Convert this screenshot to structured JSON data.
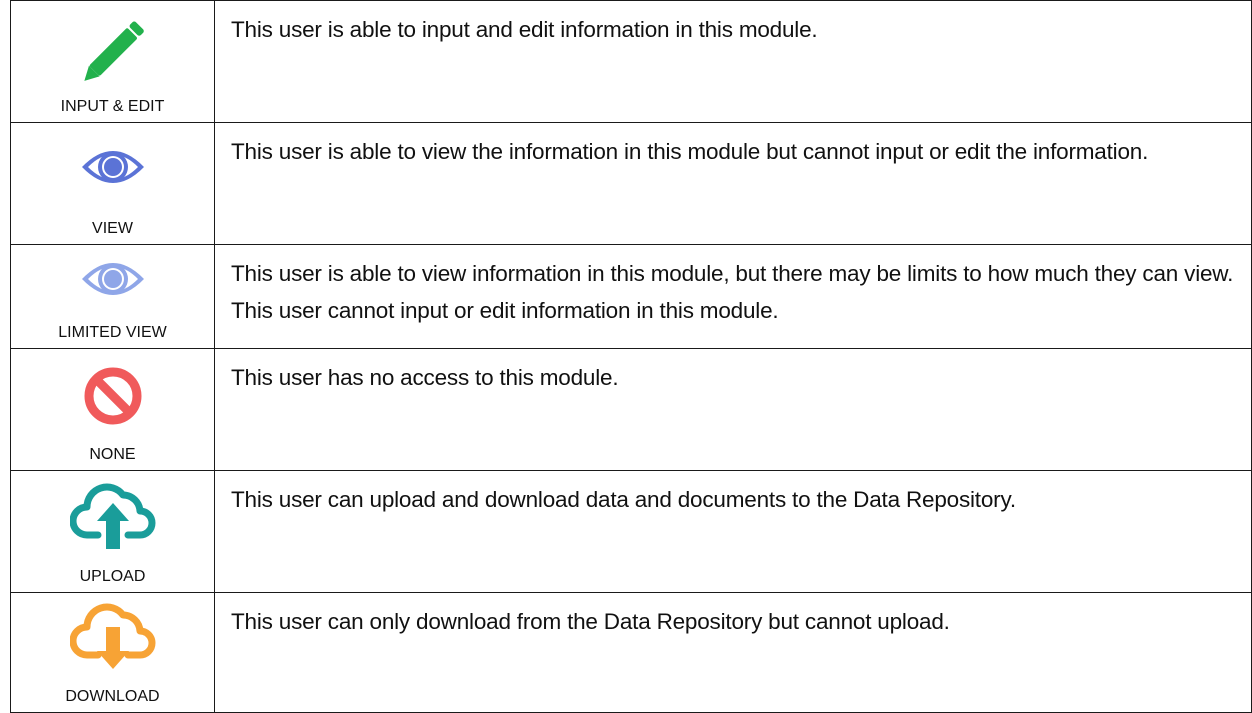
{
  "colors": {
    "edit_green": "#22b14c",
    "view_blue": "#5b73d6",
    "limited_blue": "#8fa6e8",
    "none_red": "#f05a5b",
    "upload_teal": "#1a9d9a",
    "download_orange": "#f7a335",
    "border": "#1a1a1a"
  },
  "rows": [
    {
      "icon": "pencil-icon",
      "label": "INPUT & EDIT",
      "description": "This user is able to input and edit information in this module."
    },
    {
      "icon": "eye-icon",
      "label": "VIEW",
      "description": "This user is able to view the information in this module but cannot input or edit the information."
    },
    {
      "icon": "eye-light-icon",
      "label": "LIMITED VIEW",
      "description": "This user is able to view information in this module, but there may be limits to how much they can view. This user cannot input or edit information in this module."
    },
    {
      "icon": "prohibited-icon",
      "label": "NONE",
      "description": "This user has no access to this module."
    },
    {
      "icon": "cloud-upload-icon",
      "label": "UPLOAD",
      "description": "This user can upload and download data and documents to the Data Repository."
    },
    {
      "icon": "cloud-download-icon",
      "label": "DOWNLOAD",
      "description": "This user can only download from the Data Repository but cannot upload."
    }
  ]
}
